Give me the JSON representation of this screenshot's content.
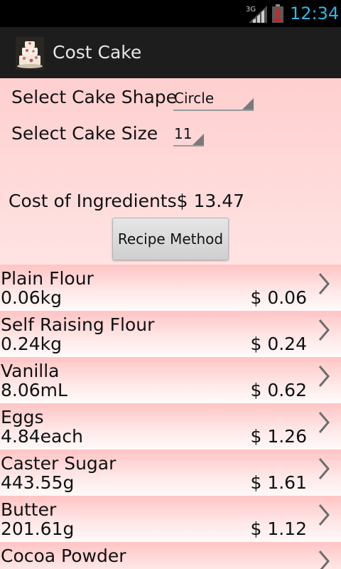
{
  "status_bar": {
    "network": "3G",
    "clock": "12:34",
    "clock_color": "#33b5e5"
  },
  "app_bar": {
    "title": "Cost Cake"
  },
  "form": {
    "shape_label": "Select Cake Shape",
    "shape_value": "Circle",
    "size_label": "Select Cake Size",
    "size_value": "11",
    "cost_label": "Cost of Ingredients",
    "cost_value": "$ 13.47",
    "recipe_button": "Recipe Method"
  },
  "ingredients": [
    {
      "name": "Plain Flour",
      "quantity": "0.06kg",
      "price": "$ 0.06"
    },
    {
      "name": "Self Raising Flour",
      "quantity": "0.24kg",
      "price": "$ 0.24"
    },
    {
      "name": "Vanilla",
      "quantity": "8.06mL",
      "price": "$ 0.62"
    },
    {
      "name": "Eggs",
      "quantity": "4.84each",
      "price": "$ 1.26"
    },
    {
      "name": "Caster Sugar",
      "quantity": "443.55g",
      "price": "$ 1.61"
    },
    {
      "name": "Butter",
      "quantity": "201.61g",
      "price": "$ 1.12"
    },
    {
      "name": "Cocoa Powder",
      "quantity": "",
      "price": ""
    }
  ],
  "icons": {
    "signal": "signal-strength-icon",
    "battery": "battery-low-icon",
    "app": "cake-icon",
    "row": "chevron-right-icon"
  }
}
